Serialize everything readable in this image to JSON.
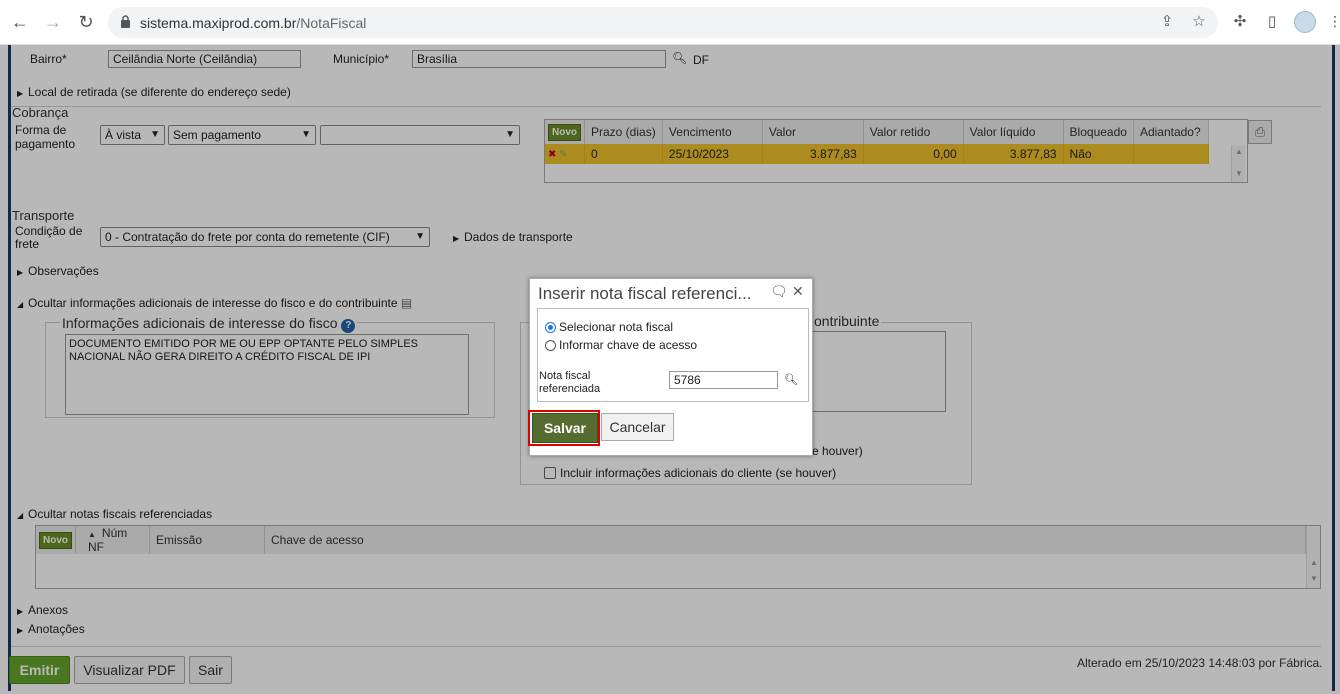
{
  "browser": {
    "url_host": "sistema.maxiprod.com.br",
    "url_path": "/NotaFiscal"
  },
  "endereco": {
    "bairro_label": "Bairro*",
    "bairro_value": "Ceilândia Norte (Ceilândia)",
    "municipio_label": "Município*",
    "municipio_value": "Brasília",
    "uf": "DF",
    "local_retirada": "Local de retirada (se diferente do endereço sede)"
  },
  "cobranca": {
    "title": "Cobrança",
    "forma_label_1": "Forma de",
    "forma_label_2": "pagamento",
    "select_vista": "À vista",
    "select_pagamento": "Sem pagamento",
    "select_empty": "",
    "novo": "Novo",
    "columns": [
      "Prazo (dias)",
      "Vencimento",
      "Valor",
      "Valor retido",
      "Valor líquido",
      "Bloqueado",
      "Adiantado?"
    ],
    "row": {
      "prazo": "0",
      "vencimento": "25/10/2023",
      "valor": "3.877,83",
      "retido": "0,00",
      "liquido": "3.877,83",
      "bloqueado": "Não",
      "adiantado": ""
    }
  },
  "transporte": {
    "title": "Transporte",
    "cond_label_1": "Condição de",
    "cond_label_2": "frete",
    "cond_value": "0 - Contratação do frete por conta do remetente (CIF)",
    "dados": "Dados de transporte"
  },
  "observacoes": "Observações",
  "info_adicionais": {
    "toggle": "Ocultar informações adicionais de interesse do fisco e do contribuinte",
    "fisco_legend": "Informações adicionais de interesse do fisco",
    "fisco_text": "DOCUMENTO EMITIDO POR ME OU EPP OPTANTE PELO SIMPLES NACIONAL NÃO GERA DIREITO A CRÉDITO FISCAL DE IPI",
    "contrib_legend_partial": "ontribuinte",
    "partial_check_text": "e houver)",
    "incluir_cliente": "Incluir informações adicionais do cliente (se houver)"
  },
  "notas_ref": {
    "toggle": "Ocultar notas fiscais referenciadas",
    "novo": "Novo",
    "columns": [
      "Núm NF",
      "Emissão",
      "Chave de acesso"
    ]
  },
  "anexos": "Anexos",
  "anotacoes": "Anotações",
  "footer": {
    "emitir": "Emitir",
    "visualizar": "Visualizar PDF",
    "sair": "Sair",
    "alterado": "Alterado em 25/10/2023 14:48:03 por Fábrica."
  },
  "modal": {
    "title": "Inserir nota fiscal referenci...",
    "opt_selecionar": "Selecionar nota fiscal",
    "opt_chave": "Informar chave de acesso",
    "nf_label_1": "Nota fiscal",
    "nf_label_2": "referenciada",
    "nf_value": "5786",
    "salvar": "Salvar",
    "cancelar": "Cancelar"
  }
}
